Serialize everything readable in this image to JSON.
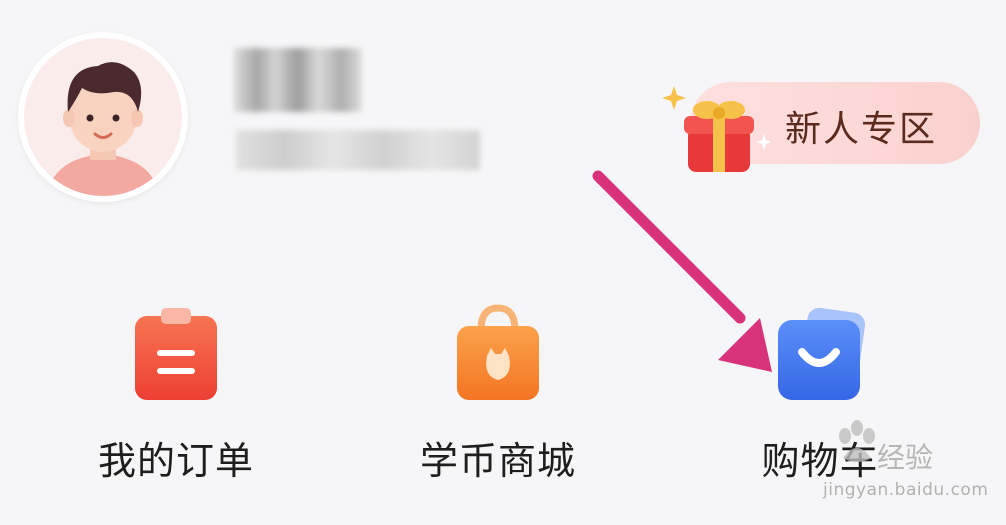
{
  "promo": {
    "label": "新人专区"
  },
  "tiles": [
    {
      "label": "我的订单",
      "icon": "clipboard-icon"
    },
    {
      "label": "学币商城",
      "icon": "shopping-bag-icon"
    },
    {
      "label": "购物车",
      "icon": "cart-icon"
    }
  ],
  "watermark": {
    "text": "经验",
    "url": "jingyan.baidu.com"
  },
  "colors": {
    "background": "#f6f6f8",
    "arrow": "#d7327a",
    "orders_icon": "#f35a3a",
    "mall_icon": "#f7832a",
    "cart_icon": "#3d78f0"
  }
}
